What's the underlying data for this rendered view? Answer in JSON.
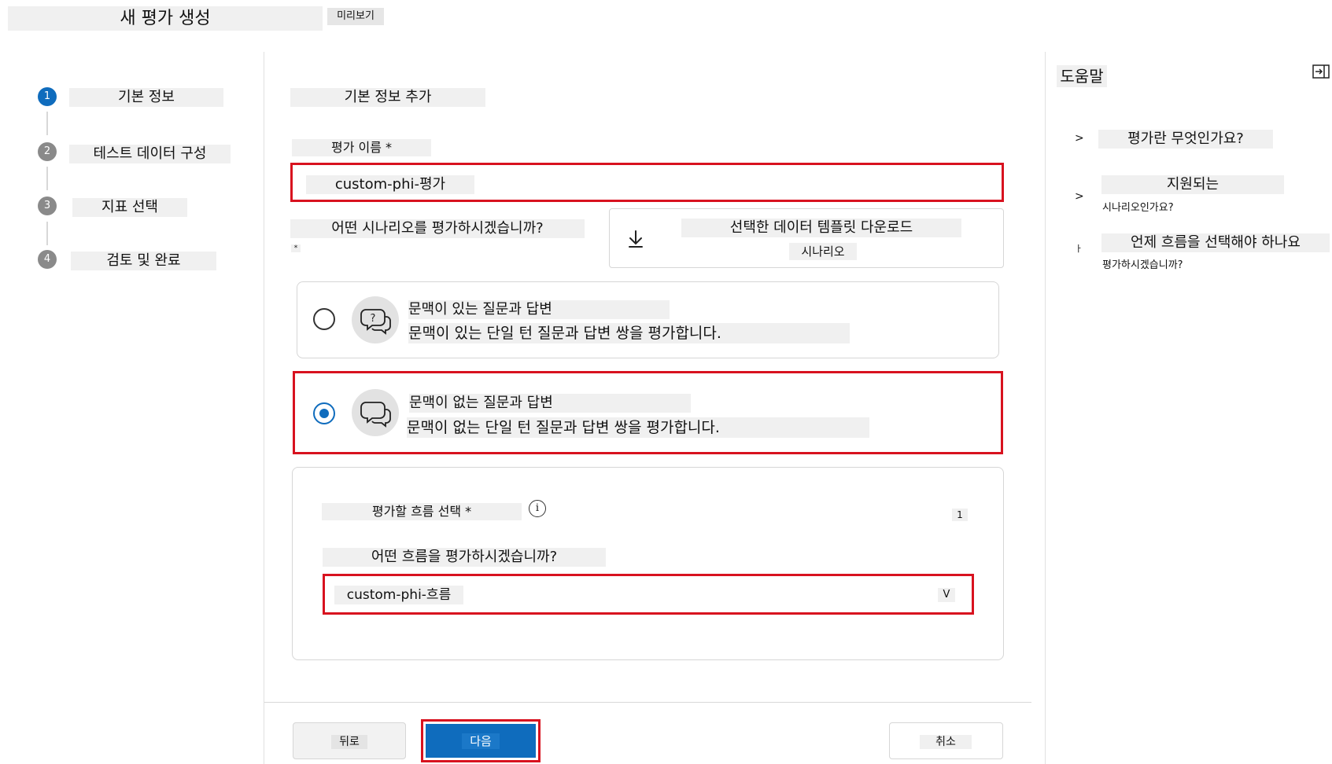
{
  "header": {
    "title": "새 평가 생성",
    "preview_label": "미리보기"
  },
  "steps": [
    {
      "number": "1",
      "label": "기본 정보",
      "active": true
    },
    {
      "number": "2",
      "label": "테스트 데이터 구성",
      "active": false
    },
    {
      "number": "3",
      "label": "지표 선택",
      "active": false
    },
    {
      "number": "4",
      "label": "검토 및 완료",
      "active": false
    }
  ],
  "form": {
    "section_title": "기본 정보 추가",
    "name_label": "평가 이름 *",
    "name_value": "custom-phi-평가",
    "scenario_label": "어떤 시나리오를 평가하시겠습니까?",
    "scenario_required": "*",
    "download_line1": "선택한 데이터 템플릿 다운로드",
    "download_line2": "시나리오",
    "options": [
      {
        "title": "문맥이 있는 질문과 답변",
        "desc": "문맥이 있는 단일 턴 질문과 답변 쌍을 평가합니다.",
        "selected": false
      },
      {
        "title": "문맥이 없는 질문과 답변",
        "desc": "문맥이 없는 단일 턴 질문과 답변 쌍을 평가합니다.",
        "selected": true
      }
    ],
    "flow": {
      "label": "평가할 흐름 선택 *",
      "count": "1",
      "question": "어떤 흐름을 평가하시겠습니까?",
      "value": "custom-phi-흐름",
      "chevron": "V"
    }
  },
  "footer": {
    "back_label": "뒤로",
    "next_label": "다음",
    "cancel_label": "취소"
  },
  "help": {
    "title": "도움말",
    "items": [
      {
        "marker": ">",
        "line1": "평가란 무엇인가요?",
        "line2": ""
      },
      {
        "marker": ">",
        "line1": "지원되는",
        "line2": "시나리오인가요?"
      },
      {
        "marker": "ㅏ",
        "line1": "언제 흐름을 선택해야 하나요",
        "line2": "평가하시겠습니까?"
      }
    ]
  },
  "colors": {
    "accent": "#0f6cbd",
    "highlight": "#d8121f",
    "step_inactive": "#8a8a8a"
  }
}
